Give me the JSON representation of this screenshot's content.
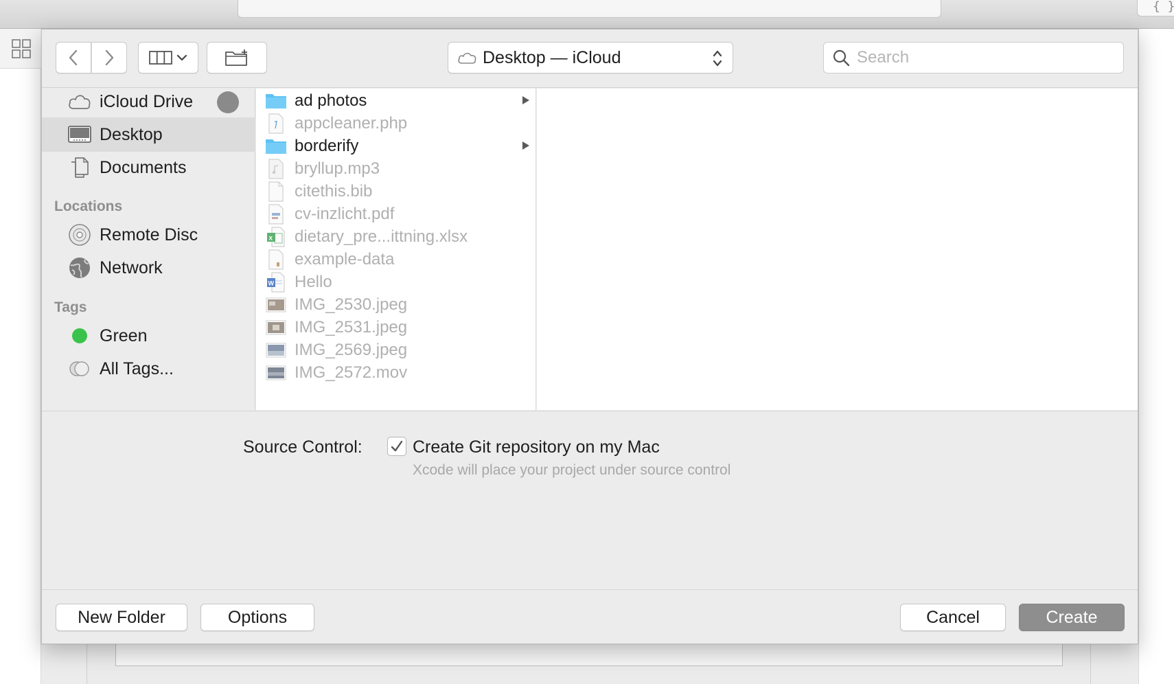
{
  "background": {
    "braces_icon": "{ }"
  },
  "toolbar": {
    "location": "Desktop — iCloud",
    "search_placeholder": "Search",
    "icons": [
      "chevron-left-icon",
      "chevron-right-icon",
      "column-view-icon",
      "new-folder-icon",
      "cloud-icon",
      "updown-arrows-icon",
      "search-icon"
    ]
  },
  "sidebar": {
    "favorites": [
      {
        "label": "iCloud Drive",
        "icon": "cloud-icon"
      },
      {
        "label": "Desktop",
        "icon": "desktop-icon",
        "selected": true
      },
      {
        "label": "Documents",
        "icon": "documents-icon"
      }
    ],
    "locations_heading": "Locations",
    "locations": [
      {
        "label": "Remote Disc",
        "icon": "disc-icon"
      },
      {
        "label": "Network",
        "icon": "globe-icon"
      }
    ],
    "tags_heading": "Tags",
    "tags": [
      {
        "label": "Green",
        "color": "#3ac34a"
      },
      {
        "label": "All Tags...",
        "icon": "all-tags-icon"
      }
    ]
  },
  "files": [
    {
      "name": "ad photos",
      "kind": "folder"
    },
    {
      "name": "appcleaner.php",
      "kind": "php"
    },
    {
      "name": "borderify",
      "kind": "folder"
    },
    {
      "name": "bryllup.mp3",
      "kind": "audio"
    },
    {
      "name": "citethis.bib",
      "kind": "doc"
    },
    {
      "name": "cv-inzlicht.pdf",
      "kind": "pdf"
    },
    {
      "name": "dietary_pre...ittning.xlsx",
      "kind": "excel"
    },
    {
      "name": "example-data",
      "kind": "doc"
    },
    {
      "name": "Hello",
      "kind": "word"
    },
    {
      "name": "IMG_2530.jpeg",
      "kind": "image"
    },
    {
      "name": "IMG_2531.jpeg",
      "kind": "image"
    },
    {
      "name": "IMG_2569.jpeg",
      "kind": "image"
    },
    {
      "name": "IMG_2572.mov",
      "kind": "video"
    }
  ],
  "options": {
    "source_control_label": "Source Control:",
    "git_checkbox_label": "Create Git repository on my Mac",
    "git_checked": true,
    "hint": "Xcode will place your project under source control"
  },
  "buttons": {
    "new_folder": "New Folder",
    "options": "Options",
    "cancel": "Cancel",
    "create": "Create"
  },
  "colors": {
    "folder_blue": "#5ec2f4",
    "create_button": "#8e8e8e",
    "tag_green": "#3ac34a"
  }
}
